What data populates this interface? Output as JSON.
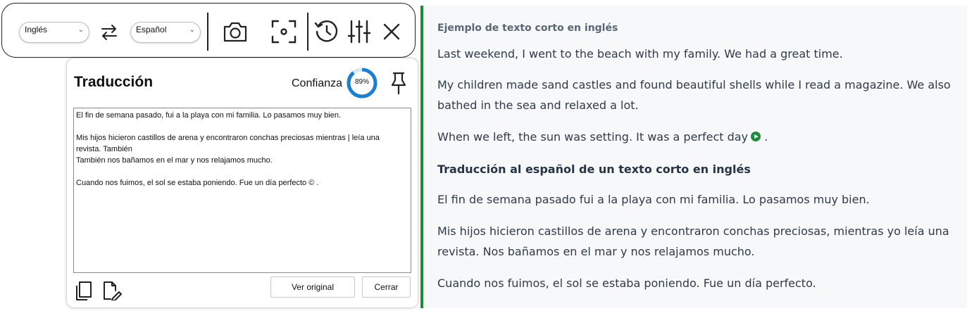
{
  "toolbar": {
    "source_lang": "Inglés",
    "target_lang": "Español",
    "icons": [
      "swap-languages-icon",
      "camera-icon",
      "screen-capture-icon",
      "history-icon",
      "settings-sliders-icon",
      "close-icon"
    ]
  },
  "panel": {
    "title": "Traducción",
    "confidence_label": "Confianza",
    "confidence_value": "89%",
    "confidence_fraction": 0.89,
    "text_lines": [
      "El fin de semana pasado, fui a la playa con mi familia. Lo pasamos muy bien.",
      "",
      "Mis hijos hicieron castillos de arena y encontraron conchas preciosas mientras | leía una",
      "revista. También",
      "También nos bañamos en el mar y nos relajamos mucho.",
      "",
      "Cuando nos fuimos, el sol se estaba poniendo. Fue un día perfecto © ."
    ],
    "view_original_label": "Ver original",
    "close_label": "Cerrar"
  },
  "article": {
    "subtitle": "Ejemplo de texto corto en inglés",
    "p1": "Last weekend, I went to the beach with my family. We had a great time.",
    "p2a": "My children made sand castles and found beautiful shells while I read a magazine. We also",
    "p2b": "bathed in the sea and relaxed a lot.",
    "p3": "When we left, the sun was setting. It was a perfect day",
    "p3_end": ".",
    "heading": "Traducción al español de un texto corto en inglés",
    "p4": "El fin de semana pasado fui a la playa con mi familia. Lo pasamos muy bien.",
    "p5a": "Mis hijos hicieron castillos de arena y encontraron conchas preciosas, mientras yo leía una",
    "p5b": "revista. Nos bañamos en el mar y nos relajamos mucho.",
    "p6": "Cuando nos fuimos, el sol se estaba poniendo. Fue un día perfecto.",
    "accent_color": "#1e8a3c"
  }
}
